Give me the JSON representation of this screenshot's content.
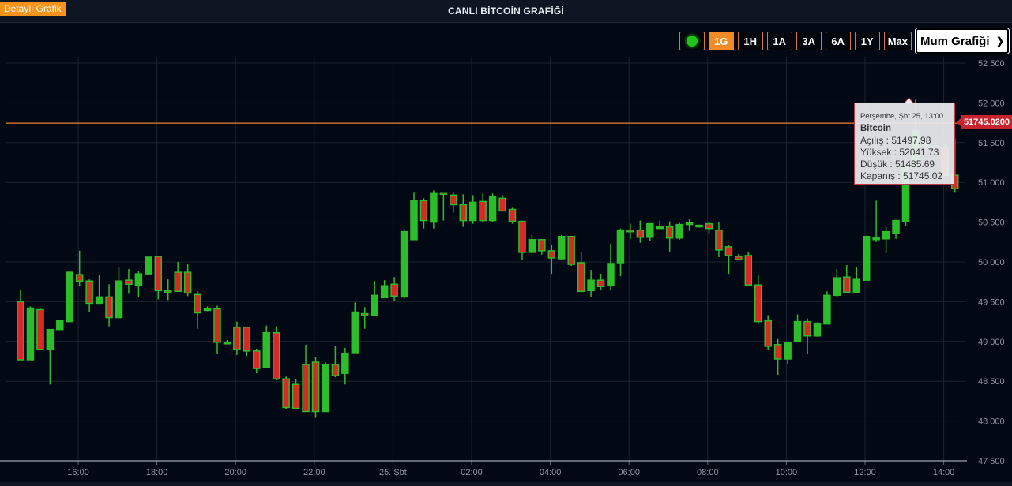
{
  "header": {
    "detail_button": "Detaylı Grafik",
    "title": "CANLI BİTCOİN GRAFİĞİ"
  },
  "controls": {
    "ranges": [
      "1G",
      "1H",
      "1A",
      "3A",
      "6A",
      "1Y",
      "Max"
    ],
    "active_range": "1G",
    "chart_type": "Mum Grafiği"
  },
  "current_price_label": "51745.0200",
  "tooltip": {
    "date": "Perşembe, Şbt 25, 13:00",
    "series": "Bitcoin",
    "open_label": "Açılış : 51497.98",
    "high_label": "Yüksek : 52041.73",
    "low_label": "Düşük : 51485.69",
    "close_label": "Kapanış : 51745.02"
  },
  "colors": {
    "up": "#2dbd2a",
    "down": "#d72a24",
    "accent": "#f28b25",
    "price_line": "#e9822d",
    "background": "#020814"
  },
  "chart_data": {
    "type": "candlestick",
    "series_name": "Bitcoin",
    "x_tick_labels": [
      "16:00",
      "18:00",
      "20:00",
      "22:00",
      "25. Şbt",
      "02:00",
      "04:00",
      "06:00",
      "08:00",
      "10:00",
      "12:00",
      "14:00"
    ],
    "y_tick_labels": [
      "47 500",
      "48 000",
      "48 500",
      "49 000",
      "49 500",
      "50 000",
      "50 500",
      "51 000",
      "51 500",
      "52 000",
      "52 500"
    ],
    "ylim": [
      47500,
      52500
    ],
    "current_price": 51745.02,
    "candles": [
      {
        "o": 49500,
        "h": 49650,
        "l": 48770,
        "c": 48770
      },
      {
        "o": 48770,
        "h": 49440,
        "l": 48770,
        "c": 49420
      },
      {
        "o": 49400,
        "h": 49420,
        "l": 48900,
        "c": 48900
      },
      {
        "o": 48900,
        "h": 49140,
        "l": 48460,
        "c": 49150
      },
      {
        "o": 49150,
        "h": 49270,
        "l": 49150,
        "c": 49260
      },
      {
        "o": 49250,
        "h": 49870,
        "l": 49250,
        "c": 49870
      },
      {
        "o": 49840,
        "h": 50140,
        "l": 49690,
        "c": 49760
      },
      {
        "o": 49760,
        "h": 49780,
        "l": 49370,
        "c": 49480
      },
      {
        "o": 49480,
        "h": 49840,
        "l": 49480,
        "c": 49560
      },
      {
        "o": 49560,
        "h": 49720,
        "l": 49190,
        "c": 49300
      },
      {
        "o": 49300,
        "h": 49930,
        "l": 49300,
        "c": 49760
      },
      {
        "o": 49770,
        "h": 49910,
        "l": 49600,
        "c": 49720
      },
      {
        "o": 49700,
        "h": 49880,
        "l": 49560,
        "c": 49850
      },
      {
        "o": 49850,
        "h": 50060,
        "l": 49850,
        "c": 50060
      },
      {
        "o": 50070,
        "h": 50070,
        "l": 49530,
        "c": 49640
      },
      {
        "o": 49640,
        "h": 49780,
        "l": 49520,
        "c": 49630
      },
      {
        "o": 49870,
        "h": 50000,
        "l": 49630,
        "c": 49630
      },
      {
        "o": 49870,
        "h": 49970,
        "l": 49570,
        "c": 49610
      },
      {
        "o": 49590,
        "h": 49630,
        "l": 49160,
        "c": 49360
      },
      {
        "o": 49400,
        "h": 49440,
        "l": 49380,
        "c": 49410
      },
      {
        "o": 49410,
        "h": 49450,
        "l": 48840,
        "c": 48990
      },
      {
        "o": 48990,
        "h": 49020,
        "l": 48990,
        "c": 48990
      },
      {
        "o": 49180,
        "h": 49250,
        "l": 48830,
        "c": 48900
      },
      {
        "o": 49180,
        "h": 49180,
        "l": 48820,
        "c": 48880
      },
      {
        "o": 48880,
        "h": 48910,
        "l": 48600,
        "c": 48660
      },
      {
        "o": 48670,
        "h": 49200,
        "l": 48670,
        "c": 49110
      },
      {
        "o": 49110,
        "h": 49190,
        "l": 48510,
        "c": 48530
      },
      {
        "o": 48530,
        "h": 48560,
        "l": 48150,
        "c": 48170
      },
      {
        "o": 48460,
        "h": 48530,
        "l": 48160,
        "c": 48160
      },
      {
        "o": 48710,
        "h": 48960,
        "l": 48120,
        "c": 48120
      },
      {
        "o": 48740,
        "h": 48800,
        "l": 48040,
        "c": 48120
      },
      {
        "o": 48120,
        "h": 48740,
        "l": 48120,
        "c": 48710
      },
      {
        "o": 48710,
        "h": 48940,
        "l": 48550,
        "c": 48570
      },
      {
        "o": 48600,
        "h": 48920,
        "l": 48460,
        "c": 48850
      },
      {
        "o": 48850,
        "h": 49490,
        "l": 48850,
        "c": 49370
      },
      {
        "o": 49350,
        "h": 49430,
        "l": 49160,
        "c": 49330
      },
      {
        "o": 49330,
        "h": 49760,
        "l": 49330,
        "c": 49580
      },
      {
        "o": 49550,
        "h": 49770,
        "l": 49550,
        "c": 49700
      },
      {
        "o": 49720,
        "h": 49810,
        "l": 49510,
        "c": 49570
      },
      {
        "o": 49560,
        "h": 50410,
        "l": 49540,
        "c": 50380
      },
      {
        "o": 50280,
        "h": 50880,
        "l": 50280,
        "c": 50770
      },
      {
        "o": 50770,
        "h": 50800,
        "l": 50420,
        "c": 50520
      },
      {
        "o": 50500,
        "h": 50900,
        "l": 50420,
        "c": 50870
      },
      {
        "o": 50870,
        "h": 50870,
        "l": 50520,
        "c": 50850
      },
      {
        "o": 50840,
        "h": 50880,
        "l": 50620,
        "c": 50720
      },
      {
        "o": 50720,
        "h": 50850,
        "l": 50440,
        "c": 50520
      },
      {
        "o": 50520,
        "h": 50840,
        "l": 50480,
        "c": 50750
      },
      {
        "o": 50760,
        "h": 50860,
        "l": 50500,
        "c": 50520
      },
      {
        "o": 50520,
        "h": 50860,
        "l": 50500,
        "c": 50820
      },
      {
        "o": 50800,
        "h": 50840,
        "l": 50640,
        "c": 50640
      },
      {
        "o": 50660,
        "h": 50680,
        "l": 50480,
        "c": 50510
      },
      {
        "o": 50510,
        "h": 50520,
        "l": 50030,
        "c": 50120
      },
      {
        "o": 50120,
        "h": 50340,
        "l": 50110,
        "c": 50280
      },
      {
        "o": 50280,
        "h": 50280,
        "l": 50090,
        "c": 50140
      },
      {
        "o": 50140,
        "h": 50210,
        "l": 49850,
        "c": 50050
      },
      {
        "o": 50040,
        "h": 50340,
        "l": 50020,
        "c": 50320
      },
      {
        "o": 50320,
        "h": 50320,
        "l": 49950,
        "c": 49970
      },
      {
        "o": 49990,
        "h": 50120,
        "l": 49620,
        "c": 49630
      },
      {
        "o": 49640,
        "h": 49900,
        "l": 49560,
        "c": 49770
      },
      {
        "o": 49770,
        "h": 49850,
        "l": 49650,
        "c": 49690
      },
      {
        "o": 49700,
        "h": 50230,
        "l": 49650,
        "c": 49980
      },
      {
        "o": 49990,
        "h": 50420,
        "l": 49820,
        "c": 50400
      },
      {
        "o": 50400,
        "h": 50480,
        "l": 50290,
        "c": 50380
      },
      {
        "o": 50400,
        "h": 50520,
        "l": 50240,
        "c": 50310
      },
      {
        "o": 50310,
        "h": 50470,
        "l": 50260,
        "c": 50480
      },
      {
        "o": 50440,
        "h": 50520,
        "l": 50410,
        "c": 50440
      },
      {
        "o": 50440,
        "h": 50510,
        "l": 50130,
        "c": 50300
      },
      {
        "o": 50300,
        "h": 50490,
        "l": 50280,
        "c": 50470
      },
      {
        "o": 50470,
        "h": 50540,
        "l": 50390,
        "c": 50490
      },
      {
        "o": 50460,
        "h": 50470,
        "l": 50440,
        "c": 50450
      },
      {
        "o": 50480,
        "h": 50500,
        "l": 50360,
        "c": 50420
      },
      {
        "o": 50400,
        "h": 50500,
        "l": 50060,
        "c": 50150
      },
      {
        "o": 50190,
        "h": 50210,
        "l": 49850,
        "c": 50080
      },
      {
        "o": 50070,
        "h": 50100,
        "l": 50030,
        "c": 50030
      },
      {
        "o": 50080,
        "h": 50130,
        "l": 49700,
        "c": 49710
      },
      {
        "o": 49710,
        "h": 49840,
        "l": 49220,
        "c": 49250
      },
      {
        "o": 49260,
        "h": 49330,
        "l": 48890,
        "c": 48940
      },
      {
        "o": 48960,
        "h": 49030,
        "l": 48580,
        "c": 48780
      },
      {
        "o": 48780,
        "h": 49000,
        "l": 48720,
        "c": 48990
      },
      {
        "o": 49000,
        "h": 49340,
        "l": 48990,
        "c": 49250
      },
      {
        "o": 49250,
        "h": 49290,
        "l": 48840,
        "c": 49070
      },
      {
        "o": 49070,
        "h": 49240,
        "l": 49060,
        "c": 49230
      },
      {
        "o": 49220,
        "h": 49630,
        "l": 49220,
        "c": 49580
      },
      {
        "o": 49580,
        "h": 49910,
        "l": 49560,
        "c": 49800
      },
      {
        "o": 49810,
        "h": 49960,
        "l": 49620,
        "c": 49620
      },
      {
        "o": 49620,
        "h": 49940,
        "l": 49620,
        "c": 49790
      },
      {
        "o": 49770,
        "h": 50330,
        "l": 49770,
        "c": 50320
      },
      {
        "o": 50280,
        "h": 50770,
        "l": 50250,
        "c": 50310
      },
      {
        "o": 50290,
        "h": 50440,
        "l": 50110,
        "c": 50380
      },
      {
        "o": 50360,
        "h": 50530,
        "l": 50290,
        "c": 50520
      },
      {
        "o": 50510,
        "h": 51100,
        "l": 50450,
        "c": 51210
      },
      {
        "o": 51210,
        "h": 52040,
        "l": 51200,
        "c": 51650
      },
      {
        "o": 51500,
        "h": 51560,
        "l": 51380,
        "c": 51460
      },
      {
        "o": 51460,
        "h": 51520,
        "l": 51380,
        "c": 51440
      },
      {
        "o": 51440,
        "h": 51480,
        "l": 51090,
        "c": 51090
      },
      {
        "o": 51090,
        "h": 51560,
        "l": 50880,
        "c": 50920
      }
    ]
  }
}
